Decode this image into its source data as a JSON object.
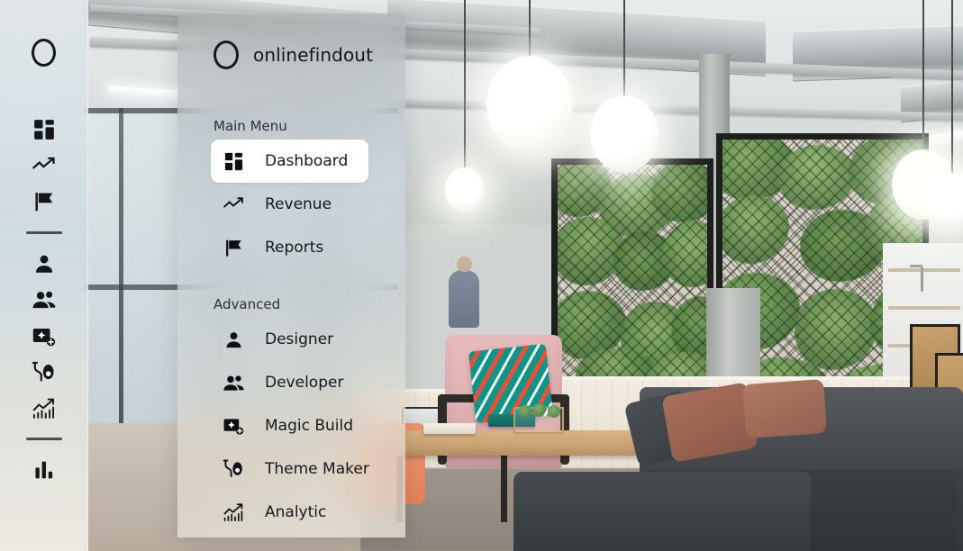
{
  "app": {
    "brand_name": "onlinefindout",
    "brand_logo_icon": "circle-o-logo"
  },
  "rail": {
    "logo_icon": "circle-o-logo",
    "items": [
      {
        "icon": "dashboard-grid-icon",
        "name": "dashboard"
      },
      {
        "icon": "trending-line-icon",
        "name": "revenue"
      },
      {
        "icon": "flag-icon",
        "name": "reports"
      },
      {
        "icon": "divider",
        "name": "divider-1"
      },
      {
        "icon": "person-icon",
        "name": "designer"
      },
      {
        "icon": "people-icon",
        "name": "developer"
      },
      {
        "icon": "magic-build-icon",
        "name": "magic-build"
      },
      {
        "icon": "theme-maker-icon",
        "name": "theme-maker"
      },
      {
        "icon": "analytic-chart-icon",
        "name": "analytic"
      },
      {
        "icon": "divider",
        "name": "divider-2"
      },
      {
        "icon": "bar-chart-icon",
        "name": "bar-chart"
      }
    ]
  },
  "menu": {
    "sections": [
      {
        "label": "Main Menu",
        "items": [
          {
            "label": "Dashboard",
            "icon": "dashboard-grid-icon",
            "active": true
          },
          {
            "label": "Revenue",
            "icon": "trending-line-icon",
            "active": false
          },
          {
            "label": "Reports",
            "icon": "flag-icon",
            "active": false
          }
        ]
      },
      {
        "label": "Advanced",
        "items": [
          {
            "label": "Designer",
            "icon": "person-icon",
            "active": false
          },
          {
            "label": "Developer",
            "icon": "people-icon",
            "active": false
          },
          {
            "label": "Magic Build",
            "icon": "magic-build-icon",
            "active": false
          },
          {
            "label": "Theme Maker",
            "icon": "theme-maker-icon",
            "active": false
          },
          {
            "label": "Analytic",
            "icon": "analytic-chart-icon",
            "active": false
          }
        ]
      }
    ]
  },
  "colors": {
    "active_item_background": "#ffffff",
    "text_primary": "#16181b",
    "section_label": "#2e3033",
    "icon": "#0e1013"
  },
  "background": {
    "scene": "modern office interior with green plant walls, pendant globe lights, exposed ductwork, brick wall, lounge seating"
  }
}
